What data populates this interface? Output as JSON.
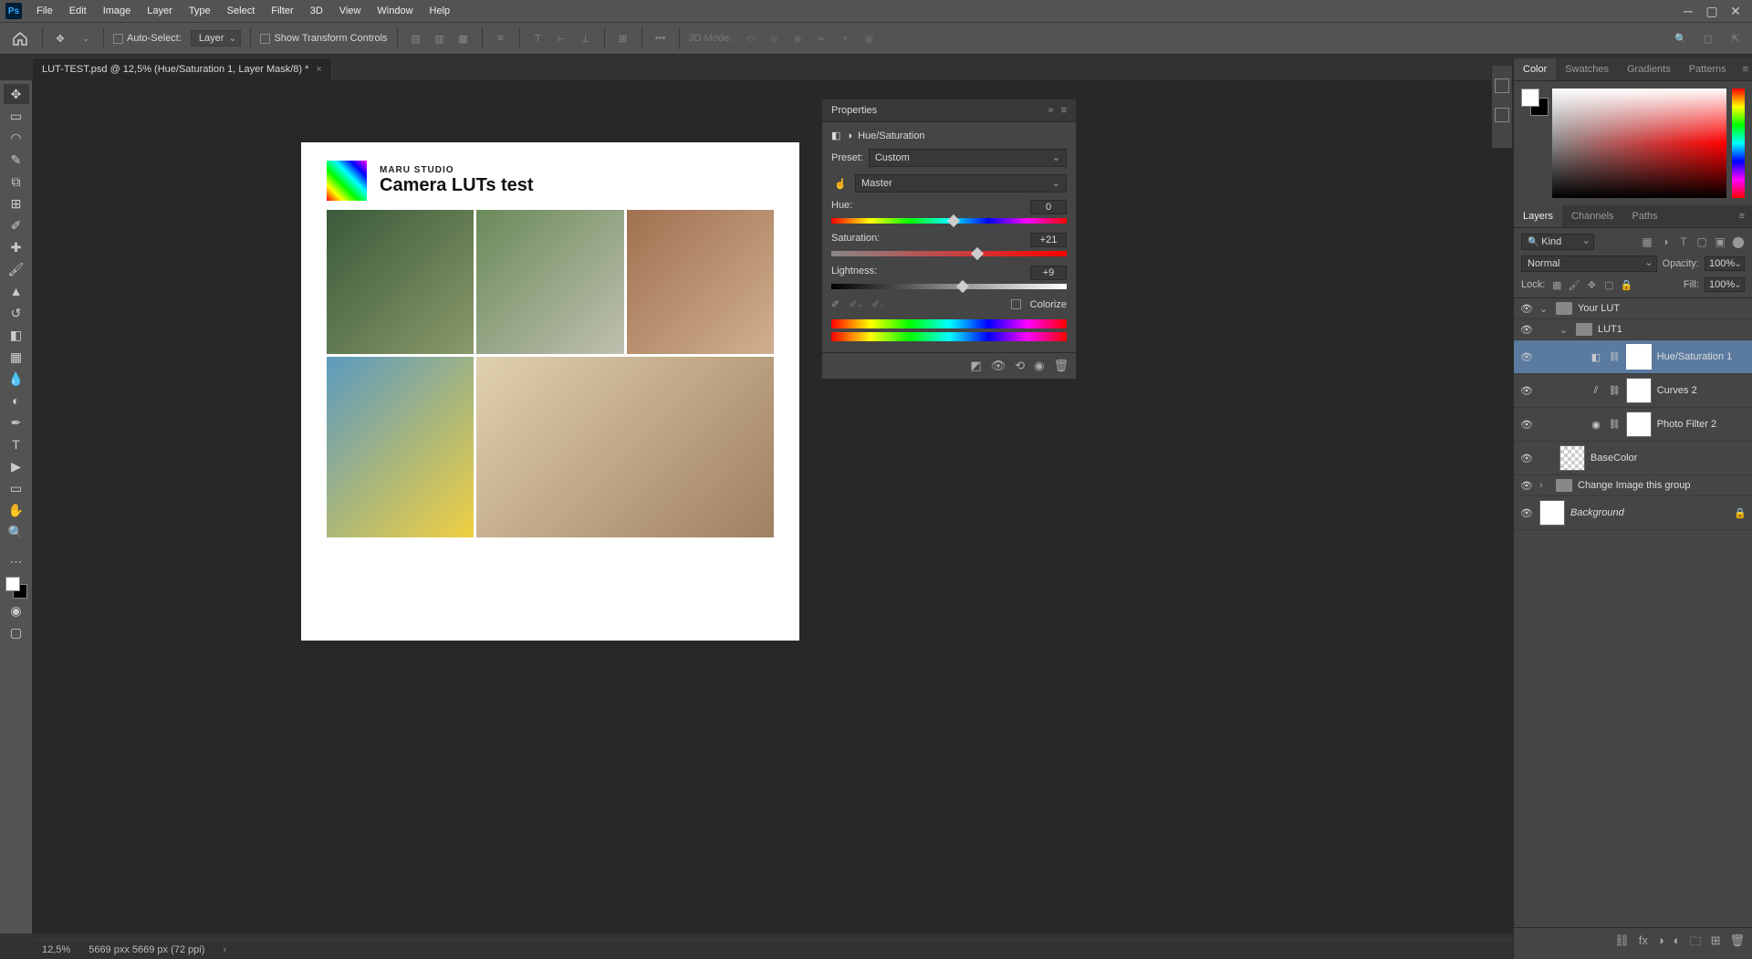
{
  "menubar": {
    "items": [
      "File",
      "Edit",
      "Image",
      "Layer",
      "Type",
      "Select",
      "Filter",
      "3D",
      "View",
      "Window",
      "Help"
    ]
  },
  "optionsbar": {
    "auto_select": "Auto-Select:",
    "layer_select": "Layer",
    "show_transform": "Show Transform Controls",
    "mode3d": "3D Mode:"
  },
  "document": {
    "tab_title": "LUT-TEST.psd @ 12,5% (Hue/Saturation 1, Layer Mask/8) *"
  },
  "canvas": {
    "studio": "MARU STUDIO",
    "title": "Camera LUTs test"
  },
  "properties": {
    "panel_title": "Properties",
    "adj_name": "Hue/Saturation",
    "preset_label": "Preset:",
    "preset_value": "Custom",
    "channel_value": "Master",
    "hue_label": "Hue:",
    "hue_value": "0",
    "sat_label": "Saturation:",
    "sat_value": "+21",
    "light_label": "Lightness:",
    "light_value": "+9",
    "colorize": "Colorize"
  },
  "color_panel": {
    "tabs": [
      "Color",
      "Swatches",
      "Gradients",
      "Patterns"
    ]
  },
  "layers_panel": {
    "tabs": [
      "Layers",
      "Channels",
      "Paths"
    ],
    "kind": "Kind",
    "blend": "Normal",
    "opacity_label": "Opacity:",
    "opacity_value": "100%",
    "lock_label": "Lock:",
    "fill_label": "Fill:",
    "fill_value": "100%",
    "layers": {
      "your_lut": "Your LUT",
      "lut1": "LUT1",
      "hue_sat": "Hue/Saturation 1",
      "curves": "Curves 2",
      "photo_filter": "Photo Filter 2",
      "base_color": "BaseColor",
      "change_group": "Change Image this group",
      "background": "Background"
    }
  },
  "statusbar": {
    "zoom": "12,5%",
    "docinfo": "5669 pxx 5669 px (72 ppi)"
  }
}
